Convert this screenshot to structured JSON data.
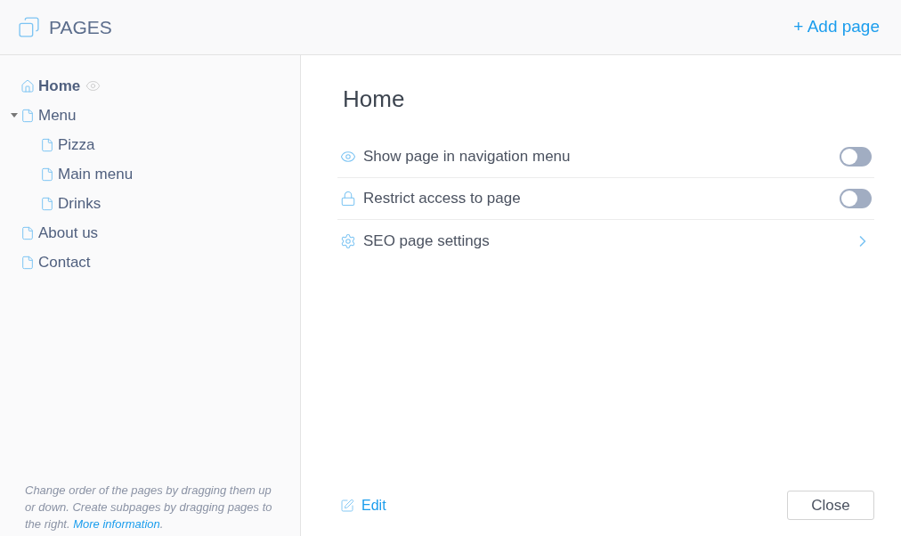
{
  "header": {
    "title": "PAGES",
    "add_button": "+ Add page"
  },
  "tree": [
    {
      "label": "Home",
      "kind": "home",
      "selected": true,
      "hidden_badge": true
    },
    {
      "label": "Menu",
      "kind": "page",
      "selected": false,
      "expanded": true,
      "children": [
        {
          "label": "Pizza",
          "kind": "page",
          "selected": false
        },
        {
          "label": "Main menu",
          "kind": "page",
          "selected": false
        },
        {
          "label": "Drinks",
          "kind": "page",
          "selected": false
        }
      ]
    },
    {
      "label": "About us",
      "kind": "page",
      "selected": false
    },
    {
      "label": "Contact",
      "kind": "page",
      "selected": false
    }
  ],
  "hint": {
    "text": "Change order of the pages by dragging them up or down. Create subpages by dragging pages to the right.",
    "link": "More information",
    "end": "."
  },
  "detail": {
    "title": "Home",
    "settings": [
      {
        "kind": "toggle",
        "label": "Show page in navigation menu",
        "on": false
      },
      {
        "kind": "toggle",
        "label": "Restrict access to page",
        "on": false
      },
      {
        "kind": "link",
        "label": "SEO page settings"
      }
    ],
    "edit": "Edit",
    "close": "Close"
  }
}
